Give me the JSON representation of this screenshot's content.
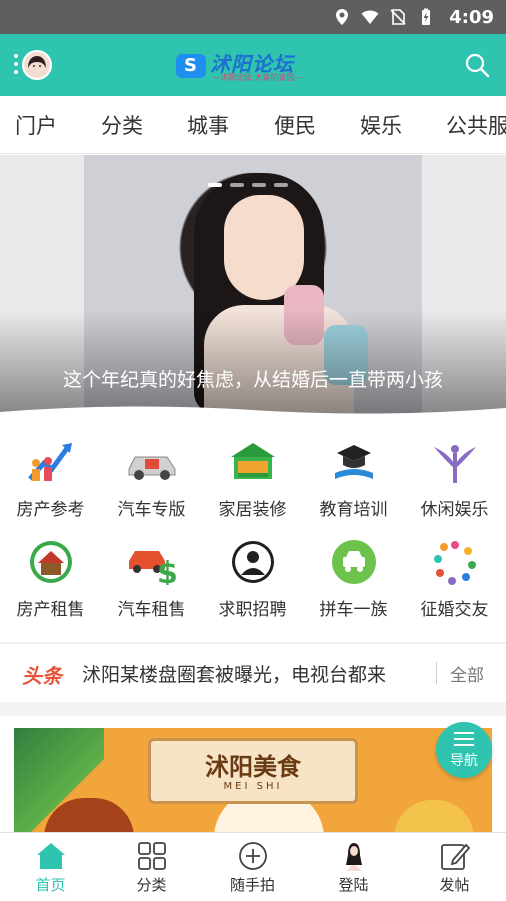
{
  "status_bar": {
    "time": "4:09"
  },
  "app_bar": {
    "logo_title": "沭阳论坛",
    "logo_subtitle": "—沭阳论坛 大家的家园—"
  },
  "tabs": [
    "门户",
    "分类",
    "城事",
    "便民",
    "娱乐",
    "公共服"
  ],
  "banner": {
    "caption": "这个年纪真的好焦虑，从结婚后一直带两小孩",
    "slide_count": 4,
    "active_slide": 1
  },
  "categories": [
    {
      "label": "房产参考",
      "icon": "house-arrow-icon"
    },
    {
      "label": "汽车专版",
      "icon": "car-icon"
    },
    {
      "label": "家居装修",
      "icon": "home-decor-icon"
    },
    {
      "label": "教育培训",
      "icon": "graduation-icon"
    },
    {
      "label": "休闲娱乐",
      "icon": "leisure-icon"
    },
    {
      "label": "房产租售",
      "icon": "house-sale-icon"
    },
    {
      "label": "汽车租售",
      "icon": "car-dollar-icon"
    },
    {
      "label": "求职招聘",
      "icon": "job-person-icon"
    },
    {
      "label": "拼车一族",
      "icon": "carpool-icon"
    },
    {
      "label": "征婚交友",
      "icon": "dating-icon"
    }
  ],
  "headline": {
    "tag": "头条",
    "title": "沭阳某楼盘圈套被曝光，电视台都来",
    "all_label": "全部"
  },
  "food_banner": {
    "title": "沭阳美食",
    "subtitle": "MEI SHI"
  },
  "nav_fab": {
    "label": "导航"
  },
  "bottom_nav": [
    {
      "label": "首页",
      "icon": "home-icon",
      "active": true
    },
    {
      "label": "分类",
      "icon": "grid-icon",
      "active": false
    },
    {
      "label": "随手拍",
      "icon": "plus-circle-icon",
      "active": false
    },
    {
      "label": "登陆",
      "icon": "avatar-icon",
      "active": false
    },
    {
      "label": "发帖",
      "icon": "edit-icon",
      "active": false
    }
  ],
  "colors": {
    "primary": "#2ec4b0",
    "status_bar": "#5f5f5f",
    "headline_tag": "#e8533a"
  }
}
